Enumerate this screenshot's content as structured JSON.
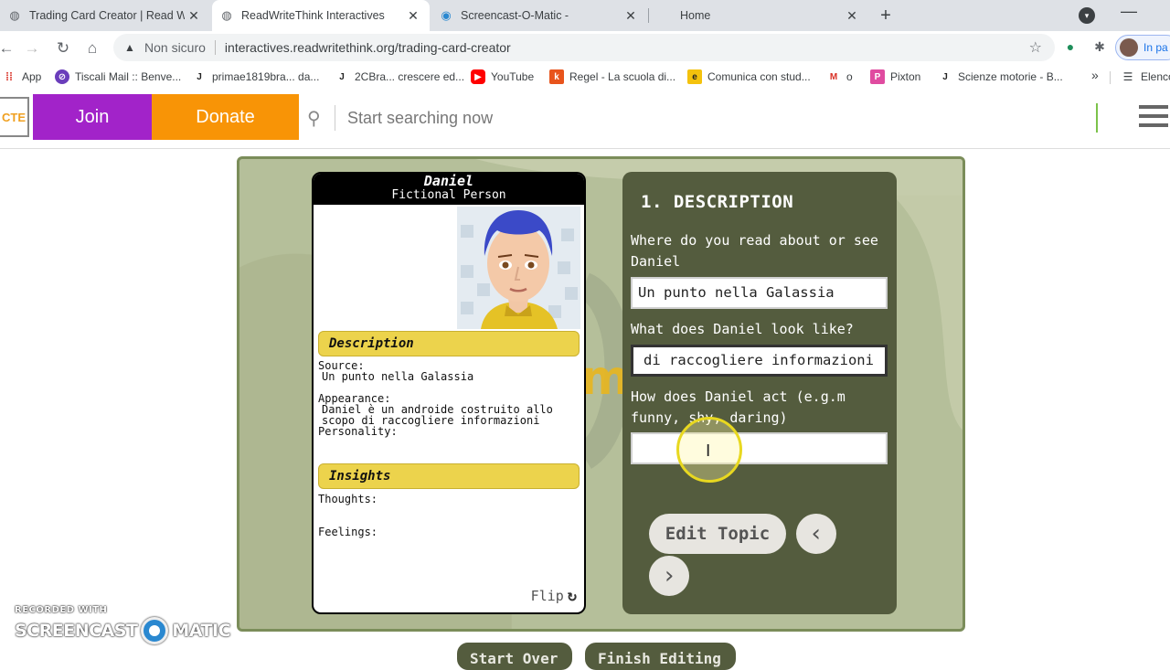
{
  "tabs": [
    {
      "title": "Trading Card Creator | Read Write",
      "icon": "globe-icon"
    },
    {
      "title": "ReadWriteThink Interactives",
      "icon": "globe-icon"
    },
    {
      "title": "Screencast-O-Matic -",
      "icon": "screencast-icon"
    },
    {
      "title": "Home",
      "icon": ""
    }
  ],
  "address": {
    "security_label": "Non sicuro",
    "url": "interactives.readwritethink.org/trading-card-creator"
  },
  "profile_label": "In pa",
  "bookmarks": [
    {
      "label": "App"
    },
    {
      "label": "Tiscali Mail :: Benve..."
    },
    {
      "label": "primae1819bra... da..."
    },
    {
      "label": "2CBra... crescere ed..."
    },
    {
      "label": "YouTube"
    },
    {
      "label": "Regel - La scuola di..."
    },
    {
      "label": "Comunica con stud..."
    },
    {
      "label": "o"
    },
    {
      "label": "Pixton"
    },
    {
      "label": "Scienze motorie - B..."
    },
    {
      "label": "Elenco"
    }
  ],
  "site": {
    "join_label": "Join",
    "donate_label": "Donate",
    "search_placeholder": "Start searching now"
  },
  "card": {
    "name": "Daniel",
    "type": "Fictional Person",
    "description_header": "Description",
    "source_label": "Source:",
    "source_value": "Un punto nella Galassia",
    "appearance_label": "Appearance:",
    "appearance_value": "Daniel è un androide costruito allo\nscopo di raccogliere informazioni",
    "personality_label": "Personality:",
    "insights_header": "Insights",
    "thoughts_label": "Thoughts:",
    "feelings_label": "Feelings:",
    "flip_label": "Flip"
  },
  "panel": {
    "title": "1. DESCRIPTION",
    "q1": "Where do you read about or see Daniel",
    "a1": "Un punto nella Galassia",
    "q2": "What does Daniel look like?",
    "a2": "di raccogliere informazioni",
    "q3": "How does Daniel act (e.g.m funny, shy, daring)",
    "a3": "",
    "edit_topic_label": "Edit Topic",
    "prev_label": "‹",
    "next_label": "›"
  },
  "bottom_buttons": [
    "Start Over",
    "Finish Editing"
  ],
  "watermark": {
    "line1": "RECORDED WITH",
    "line2a": "SCREENCAST",
    "line2b": "MATIC"
  }
}
